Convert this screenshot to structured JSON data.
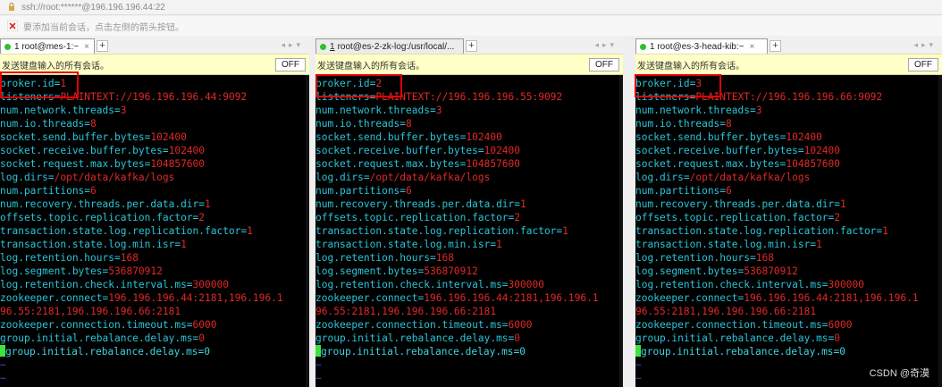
{
  "window": {
    "address": "ssh://root:******@196.196.196.44:22",
    "hint": "要添加当前会话，点击左侧的箭头按钮。"
  },
  "panes": [
    {
      "tab_num": "",
      "tab_label": "1 root@mes-1:~",
      "send_text": "发送键盘输入的所有会话。",
      "off_label": "OFF",
      "lines": [
        {
          "k": "broker.id=",
          "v": "1"
        },
        {
          "k": "listeners=",
          "v": "PLAINTEXT://196.196.196.44:9092"
        },
        {
          "k": "num.network.threads=",
          "v": "3"
        },
        {
          "k": "num.io.threads=",
          "v": "8"
        },
        {
          "k": "socket.send.buffer.bytes=",
          "v": "102400"
        },
        {
          "k": "socket.receive.buffer.bytes=",
          "v": "102400"
        },
        {
          "k": "socket.request.max.bytes=",
          "v": "104857600"
        },
        {
          "k": "log.dirs=",
          "v": "/opt/data/kafka/logs"
        },
        {
          "k": "num.partitions=",
          "v": "6"
        },
        {
          "k": "num.recovery.threads.per.data.dir=",
          "v": "1"
        },
        {
          "k": "offsets.topic.replication.factor=",
          "v": "2"
        },
        {
          "k": "transaction.state.log.replication.factor=",
          "v": "1"
        },
        {
          "k": "transaction.state.log.min.isr=",
          "v": "1"
        },
        {
          "k": "log.retention.hours=",
          "v": "168"
        },
        {
          "k": "log.segment.bytes=",
          "v": "536870912"
        },
        {
          "k": "log.retention.check.interval.ms=",
          "v": "300000"
        },
        {
          "k": "zookeeper.connect=",
          "v": "196.196.196.44:2181,196.196.1"
        },
        {
          "k": "",
          "v": "96.55:2181,196.196.196.66:2181"
        },
        {
          "k": "zookeeper.connection.timeout.ms=",
          "v": "6000"
        },
        {
          "k": "group.initial.rebalance.delay.ms=",
          "v": "0"
        }
      ],
      "comment_line": "group.initial.rebalance.delay.ms=0",
      "tilde": "~"
    },
    {
      "tab_num": "1",
      "tab_label": "root@es-2-zk-log:/usr/local/...",
      "send_text": "发送键盘输入的所有会话。",
      "off_label": "OFF",
      "lines": [
        {
          "k": "broker.id=",
          "v": "2"
        },
        {
          "k": "listeners=",
          "v": "PLAINTEXT://196.196.196.55:9092"
        },
        {
          "k": "num.network.threads=",
          "v": "3"
        },
        {
          "k": "num.io.threads=",
          "v": "8"
        },
        {
          "k": "socket.send.buffer.bytes=",
          "v": "102400"
        },
        {
          "k": "socket.receive.buffer.bytes=",
          "v": "102400"
        },
        {
          "k": "socket.request.max.bytes=",
          "v": "104857600"
        },
        {
          "k": "log.dirs=",
          "v": "/opt/data/kafka/logs"
        },
        {
          "k": "num.partitions=",
          "v": "6"
        },
        {
          "k": "num.recovery.threads.per.data.dir=",
          "v": "1"
        },
        {
          "k": "offsets.topic.replication.factor=",
          "v": "2"
        },
        {
          "k": "transaction.state.log.replication.factor=",
          "v": "1"
        },
        {
          "k": "transaction.state.log.min.isr=",
          "v": "1"
        },
        {
          "k": "log.retention.hours=",
          "v": "168"
        },
        {
          "k": "log.segment.bytes=",
          "v": "536870912"
        },
        {
          "k": "log.retention.check.interval.ms=",
          "v": "300000"
        },
        {
          "k": "zookeeper.connect=",
          "v": "196.196.196.44:2181,196.196.1"
        },
        {
          "k": "",
          "v": "96.55:2181,196.196.196.66:2181"
        },
        {
          "k": "zookeeper.connection.timeout.ms=",
          "v": "6000"
        },
        {
          "k": "group.initial.rebalance.delay.ms=",
          "v": "0"
        }
      ],
      "comment_line": "group.initial.rebalance.delay.ms=0",
      "tilde": "~"
    },
    {
      "tab_num": "",
      "tab_label": "1 root@es-3-head-kib:~",
      "send_text": "发送键盘输入的所有会话。",
      "off_label": "OFF",
      "lines": [
        {
          "k": "broker.id=",
          "v": "3"
        },
        {
          "k": "listeners=",
          "v": "PLAINTEXT://196.196.196.66:9092"
        },
        {
          "k": "num.network.threads=",
          "v": "3"
        },
        {
          "k": "num.io.threads=",
          "v": "8"
        },
        {
          "k": "socket.send.buffer.bytes=",
          "v": "102400"
        },
        {
          "k": "socket.receive.buffer.bytes=",
          "v": "102400"
        },
        {
          "k": "socket.request.max.bytes=",
          "v": "104857600"
        },
        {
          "k": "log.dirs=",
          "v": "/opt/data/kafka/logs"
        },
        {
          "k": "num.partitions=",
          "v": "6"
        },
        {
          "k": "num.recovery.threads.per.data.dir=",
          "v": "1"
        },
        {
          "k": "offsets.topic.replication.factor=",
          "v": "2"
        },
        {
          "k": "transaction.state.log.replication.factor=",
          "v": "1"
        },
        {
          "k": "transaction.state.log.min.isr=",
          "v": "1"
        },
        {
          "k": "log.retention.hours=",
          "v": "168"
        },
        {
          "k": "log.segment.bytes=",
          "v": "536870912"
        },
        {
          "k": "log.retention.check.interval.ms=",
          "v": "300000"
        },
        {
          "k": "zookeeper.connect=",
          "v": "196.196.196.44:2181,196.196.1"
        },
        {
          "k": "",
          "v": "96.55:2181,196.196.196.66:2181"
        },
        {
          "k": "zookeeper.connection.timeout.ms=",
          "v": "6000"
        },
        {
          "k": "group.initial.rebalance.delay.ms=",
          "v": "0"
        }
      ],
      "comment_line": "group.initial.rebalance.delay.ms=0",
      "tilde": "~"
    }
  ],
  "watermark": "CSDN @奇漠",
  "colors": {
    "terminal_bg": "#000000",
    "key": "#2ac5d8",
    "value": "#e02828",
    "cursor": "#3fe33f",
    "tilde": "#3a4fd8",
    "highlight": "#e00000",
    "sendbar": "#ffffc8"
  }
}
